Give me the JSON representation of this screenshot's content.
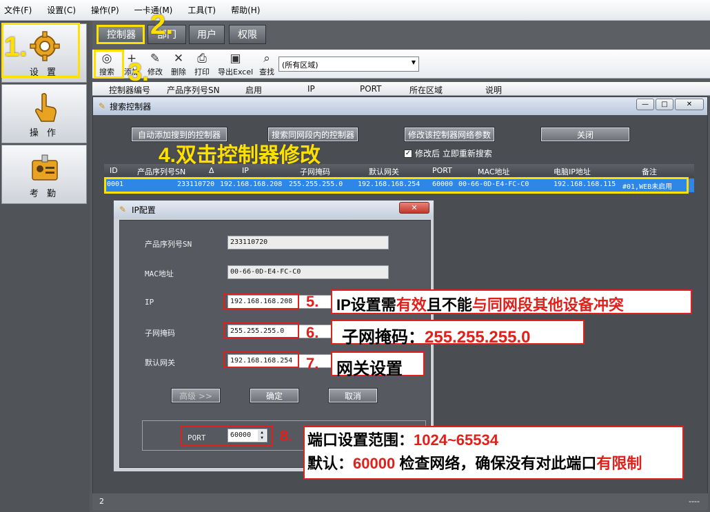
{
  "menu": [
    "文件(F)",
    "设置(C)",
    "操作(P)",
    "一卡通(M)",
    "工具(T)",
    "帮助(H)"
  ],
  "nav": [
    {
      "label": "设 置",
      "icon": "gear-icon"
    },
    {
      "label": "操 作",
      "icon": "hand-pointer-icon"
    },
    {
      "label": "考 勤",
      "icon": "id-card-icon"
    }
  ],
  "tabs": [
    "控制器",
    "部门",
    "用户",
    "权限"
  ],
  "toolbar": {
    "items": [
      {
        "label": "搜索",
        "icon": "net-search-icon"
      },
      {
        "label": "添加",
        "icon": "plus-icon"
      },
      {
        "label": "修改",
        "icon": "pencil-icon"
      },
      {
        "label": "删除",
        "icon": "x-icon"
      },
      {
        "label": "打印",
        "icon": "printer-icon"
      },
      {
        "label": "导出Excel",
        "icon": "excel-icon"
      },
      {
        "label": "查找",
        "icon": "magnifier-icon"
      }
    ],
    "area_select": "(所有区域)"
  },
  "main_columns": [
    "控制器编号",
    "产品序列号SN",
    "启用",
    "IP",
    "PORT",
    "所在区域",
    "说明"
  ],
  "search_window": {
    "title": "搜索控制器",
    "buttons": {
      "auto_add": "自动添加搜到的控制器",
      "search_same": "搜索同网段内的控制器",
      "modify_net": "修改该控制器网络参数",
      "close": "关闭"
    },
    "checkbox_label": "修改后 立即重新搜索",
    "columns": [
      "ID",
      "产品序列号SN",
      "Δ",
      "IP",
      "子网掩码",
      "默认网关",
      "PORT",
      "MAC地址",
      "电脑IP地址",
      "备注"
    ],
    "row": {
      "id": "0001",
      "sn": "233110720",
      "ip": "192.168.168.208",
      "mask": "255.255.255.0",
      "gateway": "192.168.168.254",
      "port": "60000",
      "mac": "00-66-0D-E4-FC-C0",
      "pc_ip": "192.168.168.115",
      "note": "#01,WEB未启用"
    },
    "status": "2",
    "status_right": "----"
  },
  "ip_dialog": {
    "title": "IP配置",
    "sn_label": "产品序列号SN",
    "sn_value": "233110720",
    "mac_label": "MAC地址",
    "mac_value": "00-66-0D-E4-FC-C0",
    "ip_label": "IP",
    "ip_value": "192.168.168.208",
    "mask_label": "子网掩码",
    "mask_value": "255.255.255.0",
    "gw_label": "默认网关",
    "gw_value": "192.168.168.254",
    "advanced_btn": "高级 >>",
    "ok_btn": "确定",
    "cancel_btn": "取消",
    "port_label": "PORT",
    "port_value": "60000"
  },
  "annotations": {
    "step1": "1.",
    "step2": "2.",
    "step3": "3.",
    "step4": "4.双击控制器修改",
    "n5": "5.",
    "n5_a": "IP设置需",
    "n5_b": "有效",
    "n5_c": "且不能",
    "n5_d": "与同网段其他设备冲突",
    "n6": "6.",
    "n6_a": "子网掩码：",
    "n6_b": "255.255.255.0",
    "n7": "7.",
    "n7_a": "网关设置",
    "n8": "8.",
    "n8_a": "端口设置范围：",
    "n8_b": "1024~65534",
    "n8_c": "默认：",
    "n8_d": "60000",
    "n8_e": " 检查网络，确保没有对此端口",
    "n8_f": "有限制"
  },
  "colors": {
    "selected_row": "#2f86e6",
    "annotation_yellow": "#ffe000",
    "annotation_red": "#e0201a"
  }
}
